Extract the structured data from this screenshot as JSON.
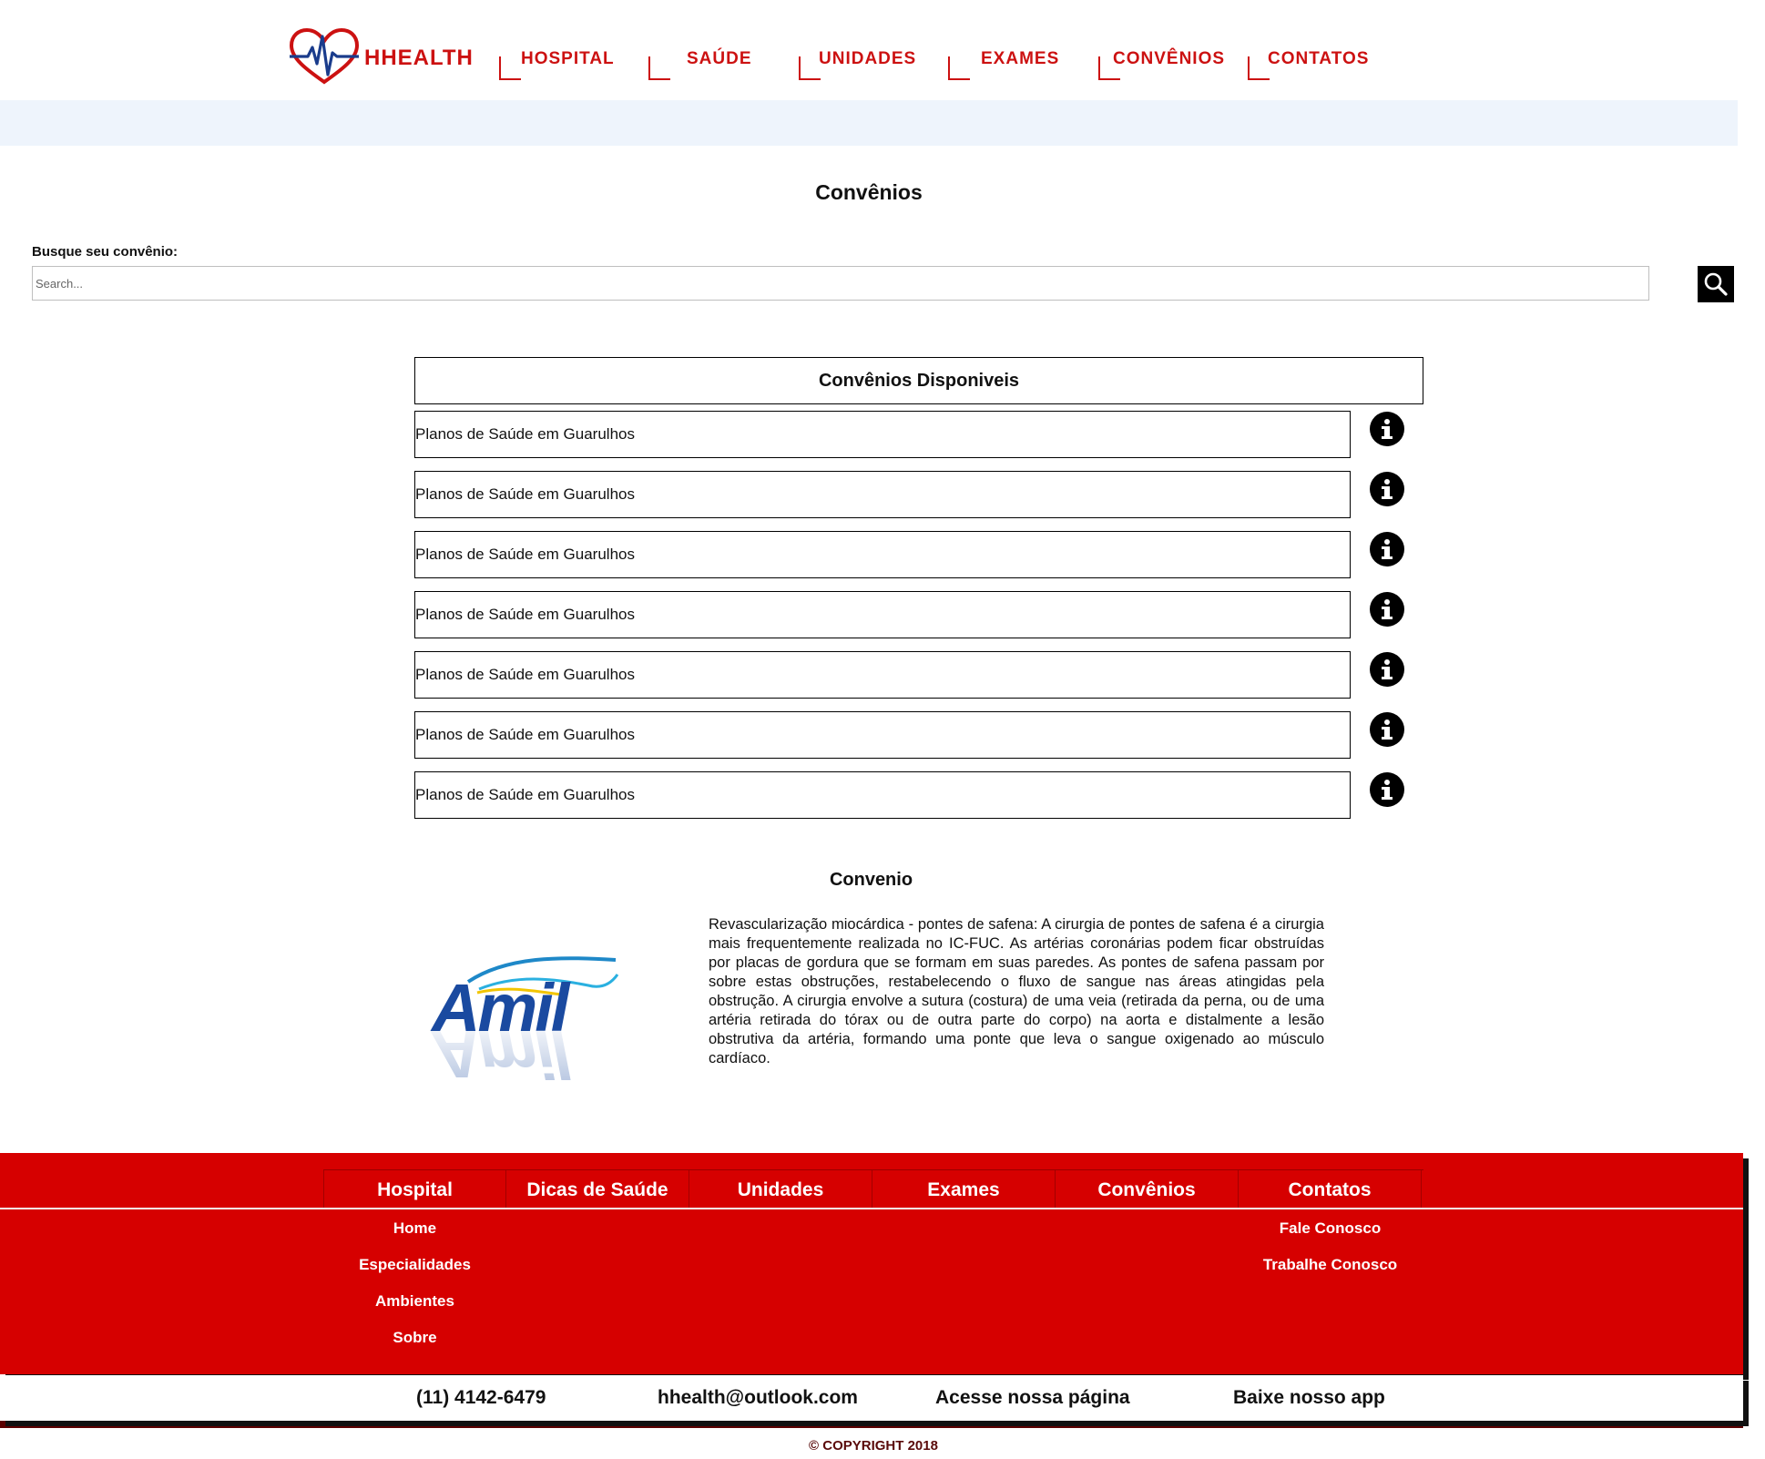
{
  "brand": {
    "name": "HHEALTH"
  },
  "nav": [
    {
      "label": "HOSPITAL"
    },
    {
      "label": "SAÚDE"
    },
    {
      "label": "UNIDADES"
    },
    {
      "label": "EXAMES"
    },
    {
      "label": "CONVÊNIOS"
    },
    {
      "label": "CONTATOS"
    }
  ],
  "page": {
    "title": "Convênios"
  },
  "search": {
    "label": "Busque seu convênio:",
    "placeholder": "Search...",
    "value": ""
  },
  "list": {
    "header": "Convênios Disponiveis",
    "items": [
      "Planos de Saúde em Guarulhos",
      "Planos de Saúde em Guarulhos",
      "Planos de Saúde em Guarulhos",
      "Planos de Saúde em Guarulhos",
      "Planos de Saúde em Guarulhos",
      "Planos de Saúde em Guarulhos",
      "Planos de Saúde em Guarulhos"
    ]
  },
  "convenio": {
    "title": "Convenio",
    "logo_text": "Amil",
    "description": "Revascularização miocárdica - pontes de safena: A cirurgia de pontes de safena é a cirurgia mais frequentemente realizada no IC-FUC. As artérias coronárias podem ficar obstruídas por placas de gordura que se formam em suas paredes. As pontes de safena passam por sobre estas obstruções, restabelecendo o fluxo de sangue nas áreas atingidas pela obstrução. A cirurgia envolve a sutura (costura) de uma veia (retirada da perna, ou de uma artéria retirada do tórax ou de outra parte do corpo) na aorta e distalmente a lesão obstrutiva da artéria, formando uma ponte que leva o sangue oxigenado ao músculo cardíaco."
  },
  "footer": {
    "columns": [
      {
        "title": "Hospital",
        "links": [
          "Home",
          "Especialidades",
          "Ambientes",
          "Sobre"
        ]
      },
      {
        "title": "Dicas de Saúde",
        "links": []
      },
      {
        "title": "Unidades",
        "links": []
      },
      {
        "title": "Exames",
        "links": []
      },
      {
        "title": "Convênios",
        "links": []
      },
      {
        "title": "Contatos",
        "links": [
          "Fale Conosco",
          "Trabalhe Conosco"
        ]
      }
    ],
    "contact": {
      "phone": "(11) 4142-6479",
      "email": "hhealth@outlook.com",
      "page": "Acesse nossa página",
      "app": "Baixe nosso app"
    },
    "copyright": "© COPYRIGHT 2018"
  },
  "icons": {
    "logo": "heart-pulse-icon",
    "search": "magnifier-icon",
    "info": "info-icon"
  },
  "colors": {
    "brand_red": "#cc1111",
    "footer_red": "#d60000",
    "banner": "#eef4fc"
  }
}
